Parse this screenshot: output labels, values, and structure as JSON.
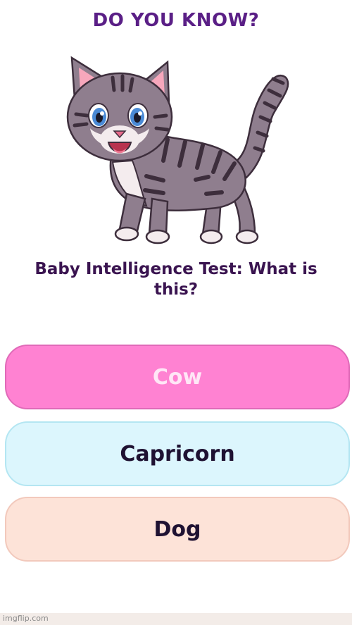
{
  "header": {
    "title": "DO YOU KNOW?"
  },
  "illustration": {
    "icon": "cat-icon"
  },
  "question": {
    "line1": "Baby Intelligence Test: What is",
    "line2": "this?"
  },
  "answers": [
    {
      "label": "Cow",
      "color": "#ff82d2"
    },
    {
      "label": "Capricorn",
      "color": "#dcf6fd"
    },
    {
      "label": "Dog",
      "color": "#fde3d8"
    }
  ],
  "watermark": "imgflip.com",
  "colors": {
    "title": "#5a1f86",
    "question": "#3a1450",
    "cat_fur": "#8f7e8e",
    "cat_stripes": "#3d2e3c"
  }
}
